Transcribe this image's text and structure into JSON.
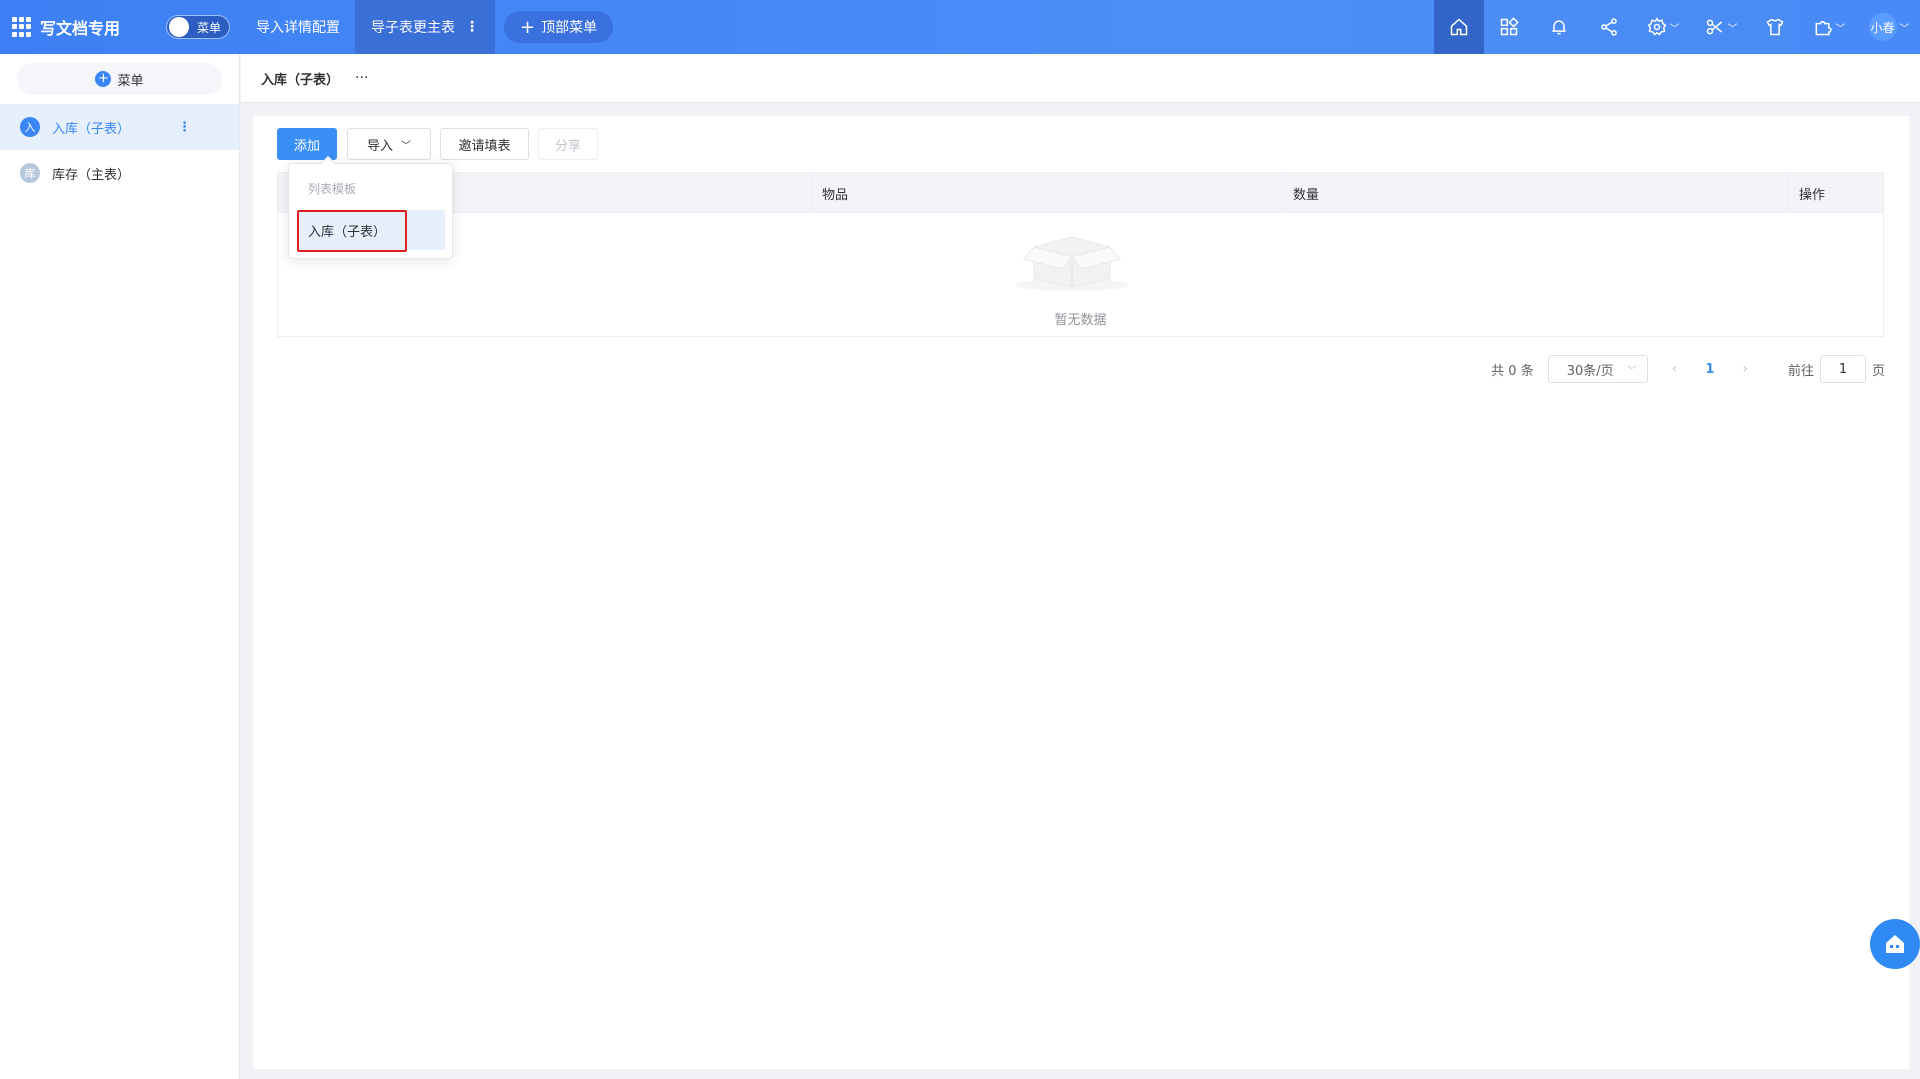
{
  "app": {
    "title": "写文档专用",
    "menu_toggle_label": "菜单"
  },
  "topnav": {
    "items": [
      {
        "label": "导入详情配置"
      },
      {
        "label": "导子表更主表",
        "more": "⋮"
      }
    ],
    "add_top_menu": "顶部菜单",
    "user_name": "小春",
    "icons": [
      "home-icon",
      "apps-icon",
      "bell-icon",
      "share-icon",
      "gear-icon",
      "scissors-icon",
      "shirt-icon",
      "puzzle-icon"
    ]
  },
  "sidebar": {
    "menu_button": "菜单",
    "items": [
      {
        "badge": "入",
        "label": "入库（子表）",
        "badge_color": "#3a86f6"
      },
      {
        "badge": "库",
        "label": "库存（主表）",
        "badge_color": "#b8c8dc"
      }
    ]
  },
  "breadcrumb": {
    "title": "入库（子表）",
    "more": "···"
  },
  "toolbar": {
    "add": "添加",
    "import": "导入",
    "invite": "邀请填表",
    "share": "分享"
  },
  "dropdown": {
    "group_title": "列表模板",
    "option": "入库（子表）"
  },
  "table": {
    "columns": [
      "物品",
      "数量",
      "操作"
    ],
    "empty_text": "暂无数据"
  },
  "pagination": {
    "total": "共 0 条",
    "page_size": "30条/页",
    "current_page": "1",
    "goto_label": "前往",
    "goto_value": "1",
    "page_suffix": "页"
  },
  "colors": {
    "accent": "#3a8ff6",
    "topbar": "#4a8af6"
  }
}
